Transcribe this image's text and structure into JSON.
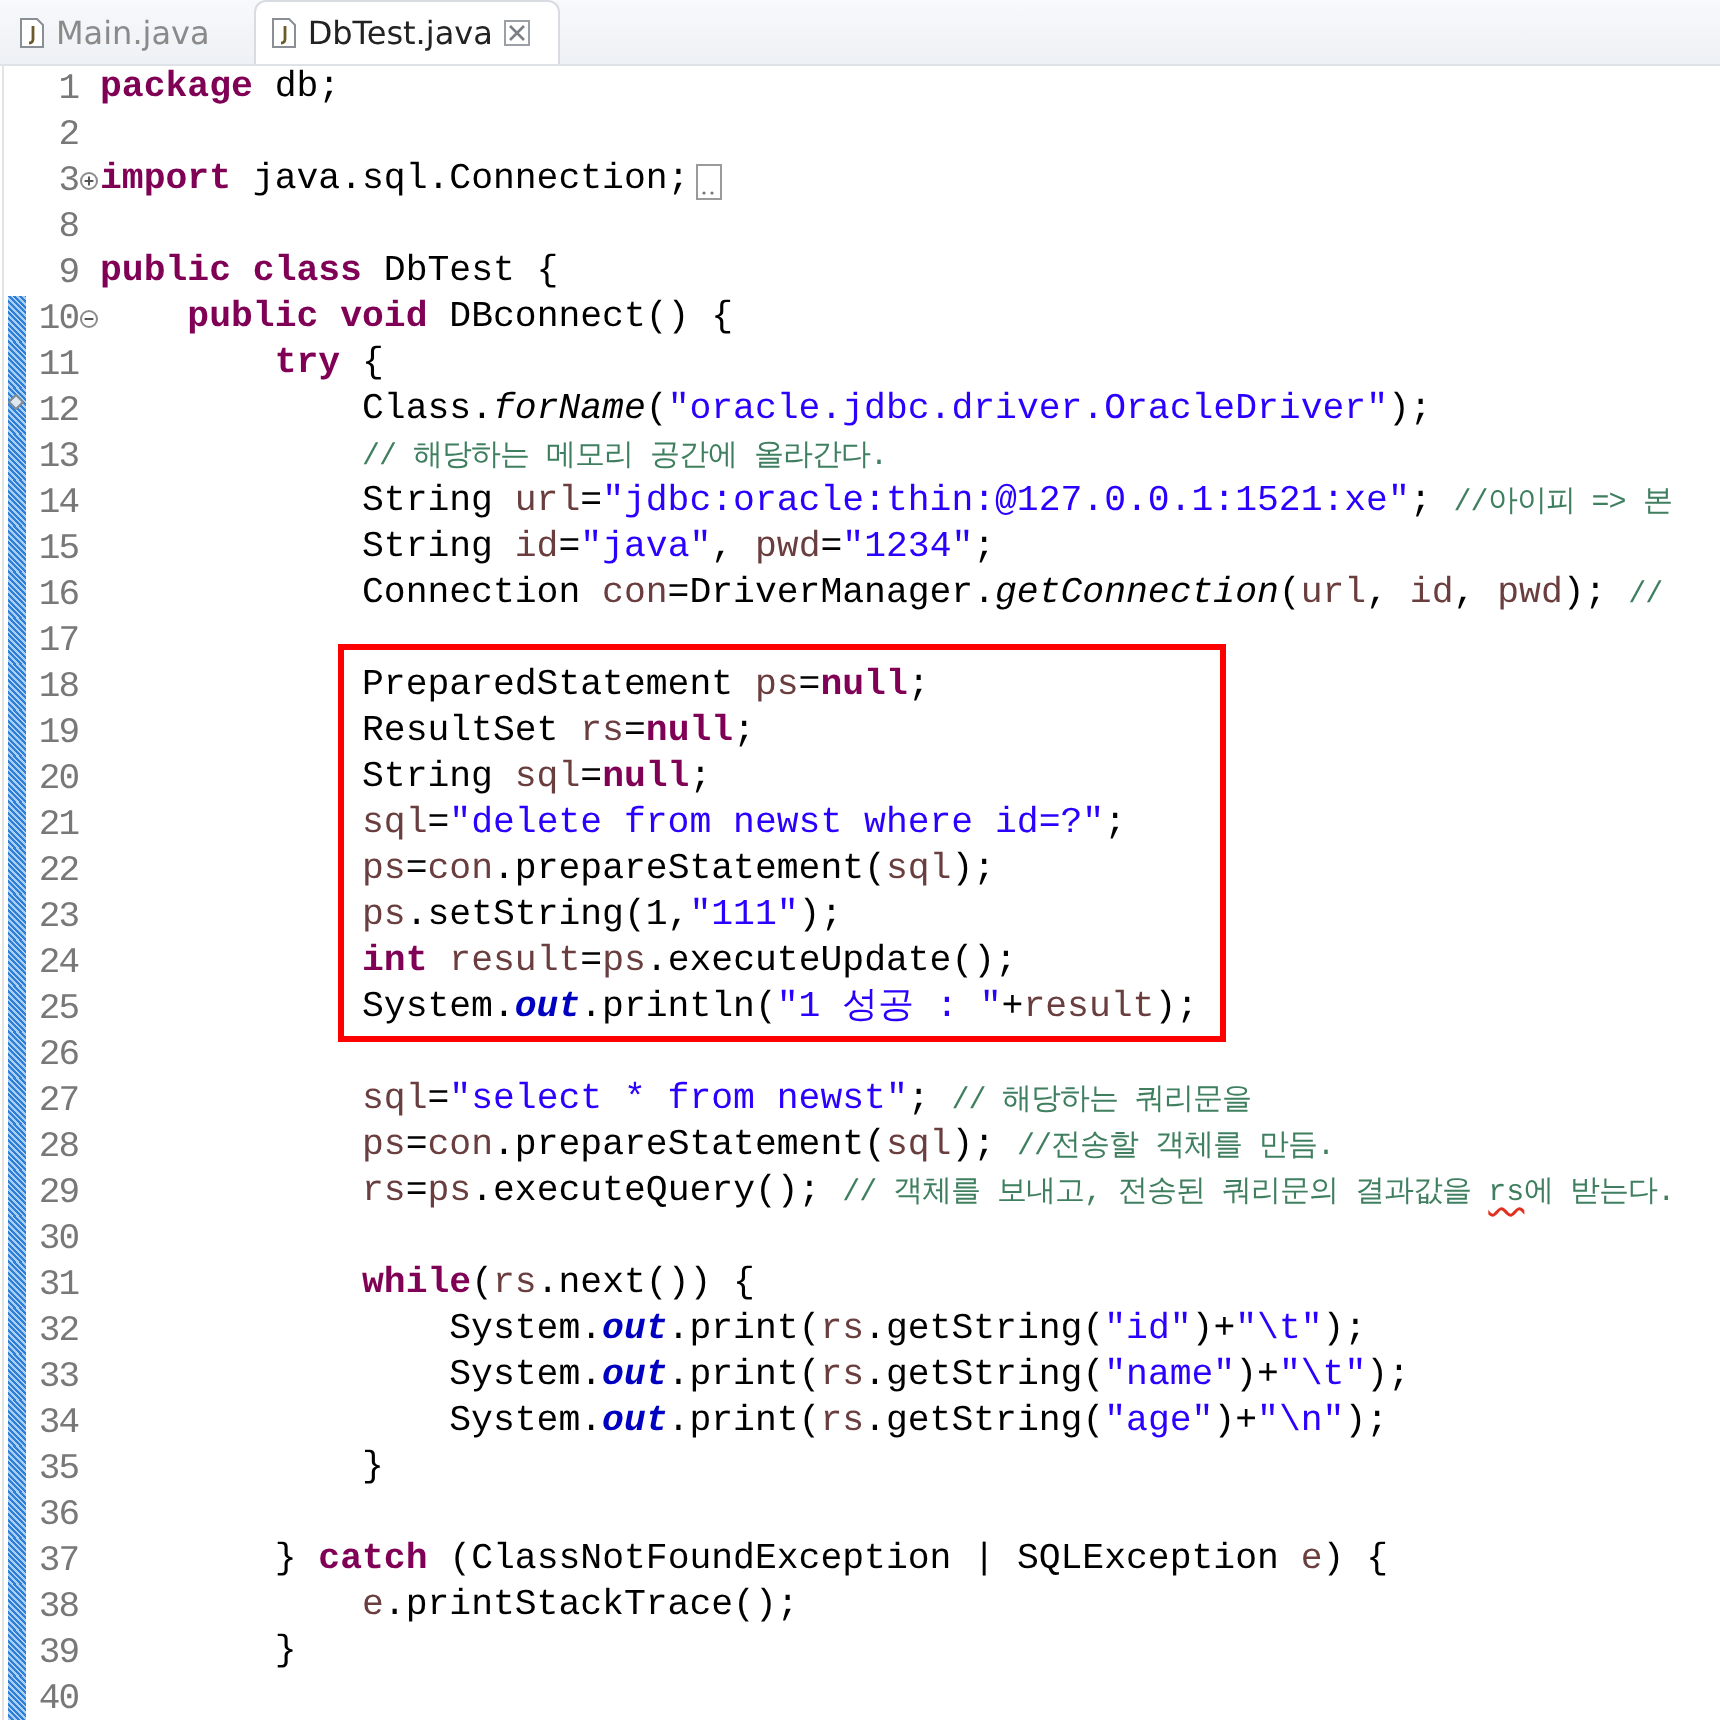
{
  "tabs": [
    {
      "label": "Main.java",
      "selected": false,
      "closable": false
    },
    {
      "label": "DbTest.java",
      "selected": true,
      "closable": true
    }
  ],
  "editor": {
    "lines": [
      {
        "number": "1",
        "changed": false,
        "tokens": [
          {
            "kind": "keyword",
            "text": "package"
          },
          {
            "kind": "plain",
            "text": " db;"
          }
        ]
      },
      {
        "number": "2",
        "changed": false
      },
      {
        "number": "3",
        "changed": false,
        "expanded": false,
        "tokens": [
          {
            "kind": "keyword",
            "text": "import"
          },
          {
            "kind": "plain",
            "text": " java.sql.Connection;"
          }
        ]
      },
      {
        "number": "8",
        "changed": false
      },
      {
        "number": "9",
        "changed": false,
        "tokens": [
          {
            "kind": "keyword",
            "text": "public class"
          },
          {
            "kind": "plain",
            "text": " DbTest {"
          }
        ]
      },
      {
        "number": "10",
        "changed": true,
        "expanded": true,
        "tokens": [
          {
            "kind": "keyword",
            "text": "    public void"
          },
          {
            "kind": "plain",
            "text": " DBconnect() {"
          }
        ]
      },
      {
        "number": "11",
        "changed": true,
        "tokens": [
          {
            "kind": "keyword",
            "text": "        try"
          },
          {
            "kind": "plain",
            "text": " {"
          }
        ]
      },
      {
        "number": "12",
        "changed": true,
        "annotation": true,
        "tokens": [
          {
            "kind": "plain",
            "text": "            Class."
          },
          {
            "kind": "static",
            "text": "forName"
          },
          {
            "kind": "plain",
            "text": "("
          },
          {
            "kind": "string",
            "text": "\"oracle.jdbc.driver.OracleDriver\""
          },
          {
            "kind": "plain",
            "text": ");"
          }
        ]
      },
      {
        "number": "13",
        "changed": true,
        "tokens": [
          {
            "kind": "comment",
            "text": "            // 해당하는 메모리 공간에 올라간다."
          }
        ]
      },
      {
        "number": "14",
        "changed": true,
        "tokens": [
          {
            "kind": "plain",
            "text": "            String "
          },
          {
            "kind": "var",
            "text": "url"
          },
          {
            "kind": "plain",
            "text": "="
          },
          {
            "kind": "string",
            "text": "\"jdbc:oracle:thin:@127.0.0.1:1521:xe\""
          },
          {
            "kind": "plain",
            "text": "; "
          },
          {
            "kind": "comment",
            "text": "//아이피 => 본"
          }
        ]
      },
      {
        "number": "15",
        "changed": true,
        "tokens": [
          {
            "kind": "plain",
            "text": "            String "
          },
          {
            "kind": "var",
            "text": "id"
          },
          {
            "kind": "plain",
            "text": "="
          },
          {
            "kind": "string",
            "text": "\"java\""
          },
          {
            "kind": "plain",
            "text": ", "
          },
          {
            "kind": "var",
            "text": "pwd"
          },
          {
            "kind": "plain",
            "text": "="
          },
          {
            "kind": "string",
            "text": "\"1234\""
          },
          {
            "kind": "plain",
            "text": ";"
          }
        ]
      },
      {
        "number": "16",
        "changed": true,
        "tokens": [
          {
            "kind": "plain",
            "text": "            Connection "
          },
          {
            "kind": "var",
            "text": "con"
          },
          {
            "kind": "plain",
            "text": "=DriverManager."
          },
          {
            "kind": "static",
            "text": "getConnection"
          },
          {
            "kind": "plain",
            "text": "("
          },
          {
            "kind": "var",
            "text": "url"
          },
          {
            "kind": "plain",
            "text": ", "
          },
          {
            "kind": "var",
            "text": "id"
          },
          {
            "kind": "plain",
            "text": ", "
          },
          {
            "kind": "var",
            "text": "pwd"
          },
          {
            "kind": "plain",
            "text": "); "
          },
          {
            "kind": "comment",
            "text": "//"
          }
        ]
      },
      {
        "number": "17",
        "changed": true
      },
      {
        "kind": "highlight",
        "lines": [
          {
            "number": "18",
            "changed": true,
            "tokens": [
              {
                "kind": "plain",
                "text": "            PreparedStatement "
              },
              {
                "kind": "var",
                "text": "ps"
              },
              {
                "kind": "plain",
                "text": "="
              },
              {
                "kind": "keyword",
                "text": "null"
              },
              {
                "kind": "plain",
                "text": ";"
              }
            ]
          },
          {
            "number": "19",
            "changed": true,
            "tokens": [
              {
                "kind": "plain",
                "text": "            ResultSet "
              },
              {
                "kind": "var",
                "text": "rs"
              },
              {
                "kind": "plain",
                "text": "="
              },
              {
                "kind": "keyword",
                "text": "null"
              },
              {
                "kind": "plain",
                "text": ";"
              }
            ]
          },
          {
            "number": "20",
            "changed": true,
            "tokens": [
              {
                "kind": "plain",
                "text": "            String "
              },
              {
                "kind": "var",
                "text": "sql"
              },
              {
                "kind": "plain",
                "text": "="
              },
              {
                "kind": "keyword",
                "text": "null"
              },
              {
                "kind": "plain",
                "text": ";"
              }
            ]
          },
          {
            "number": "21",
            "changed": true,
            "tokens": [
              {
                "kind": "var",
                "text": "            sql"
              },
              {
                "kind": "plain",
                "text": "="
              },
              {
                "kind": "string",
                "text": "\"delete from newst where id=?\""
              },
              {
                "kind": "plain",
                "text": ";"
              }
            ]
          },
          {
            "number": "22",
            "changed": true,
            "tokens": [
              {
                "kind": "var",
                "text": "            ps"
              },
              {
                "kind": "plain",
                "text": "="
              },
              {
                "kind": "var",
                "text": "con"
              },
              {
                "kind": "plain",
                "text": ".prepareStatement("
              },
              {
                "kind": "var",
                "text": "sql"
              },
              {
                "kind": "plain",
                "text": ");"
              }
            ]
          },
          {
            "number": "23",
            "changed": true,
            "tokens": [
              {
                "kind": "var",
                "text": "            ps"
              },
              {
                "kind": "plain",
                "text": ".setString(1,"
              },
              {
                "kind": "string",
                "text": "\"111\""
              },
              {
                "kind": "plain",
                "text": ");"
              }
            ]
          },
          {
            "number": "24",
            "changed": true,
            "tokens": [
              {
                "kind": "keyword",
                "text": "            int"
              },
              {
                "kind": "var",
                "text": " result"
              },
              {
                "kind": "plain",
                "text": "="
              },
              {
                "kind": "var",
                "text": "ps"
              },
              {
                "kind": "plain",
                "text": ".executeUpdate();"
              }
            ]
          },
          {
            "number": "25",
            "changed": true,
            "tokens": [
              {
                "kind": "plain",
                "text": "            System."
              },
              {
                "kind": "field",
                "text": "out"
              },
              {
                "kind": "plain",
                "text": ".println("
              },
              {
                "kind": "string",
                "text": "\"1 성공 : \""
              },
              {
                "kind": "plain",
                "text": "+"
              },
              {
                "kind": "var",
                "text": "result"
              },
              {
                "kind": "plain",
                "text": ");"
              }
            ]
          }
        ]
      },
      {
        "number": "26",
        "changed": true
      },
      {
        "number": "27",
        "changed": true,
        "tokens": [
          {
            "kind": "var",
            "text": "            sql"
          },
          {
            "kind": "plain",
            "text": "="
          },
          {
            "kind": "string",
            "text": "\"select * from newst\""
          },
          {
            "kind": "plain",
            "text": "; "
          },
          {
            "kind": "comment",
            "text": "// 해당하는 쿼리문을"
          }
        ]
      },
      {
        "number": "28",
        "changed": true,
        "tokens": [
          {
            "kind": "var",
            "text": "            ps"
          },
          {
            "kind": "plain",
            "text": "="
          },
          {
            "kind": "var",
            "text": "con"
          },
          {
            "kind": "plain",
            "text": ".prepareStatement("
          },
          {
            "kind": "var",
            "text": "sql"
          },
          {
            "kind": "plain",
            "text": "); "
          },
          {
            "kind": "comment",
            "text": "//전송할 객체를 만듬."
          }
        ]
      },
      {
        "number": "29",
        "changed": true,
        "tokens": [
          {
            "kind": "var",
            "text": "            rs"
          },
          {
            "kind": "plain",
            "text": "="
          },
          {
            "kind": "var",
            "text": "ps"
          },
          {
            "kind": "plain",
            "text": ".executeQuery(); "
          },
          {
            "kind": "comment",
            "text": "// 객체를 보내고, 전송된 쿼리문의 결과값을 "
          },
          {
            "kind": "misspelled",
            "text": "rs"
          },
          {
            "kind": "comment",
            "text": "에 받는다."
          }
        ]
      },
      {
        "number": "30",
        "changed": true
      },
      {
        "number": "31",
        "changed": true,
        "tokens": [
          {
            "kind": "keyword",
            "text": "            while"
          },
          {
            "kind": "plain",
            "text": "("
          },
          {
            "kind": "var",
            "text": "rs"
          },
          {
            "kind": "plain",
            "text": ".next()) {"
          }
        ]
      },
      {
        "number": "32",
        "changed": true,
        "tokens": [
          {
            "kind": "plain",
            "text": "                System."
          },
          {
            "kind": "field",
            "text": "out"
          },
          {
            "kind": "plain",
            "text": ".print("
          },
          {
            "kind": "var",
            "text": "rs"
          },
          {
            "kind": "plain",
            "text": ".getString("
          },
          {
            "kind": "string",
            "text": "\"id\""
          },
          {
            "kind": "plain",
            "text": ")+"
          },
          {
            "kind": "string",
            "text": "\"\\t\""
          },
          {
            "kind": "plain",
            "text": ");"
          }
        ]
      },
      {
        "number": "33",
        "changed": true,
        "tokens": [
          {
            "kind": "plain",
            "text": "                System."
          },
          {
            "kind": "field",
            "text": "out"
          },
          {
            "kind": "plain",
            "text": ".print("
          },
          {
            "kind": "var",
            "text": "rs"
          },
          {
            "kind": "plain",
            "text": ".getString("
          },
          {
            "kind": "string",
            "text": "\"name\""
          },
          {
            "kind": "plain",
            "text": ")+"
          },
          {
            "kind": "string",
            "text": "\"\\t\""
          },
          {
            "kind": "plain",
            "text": ");"
          }
        ]
      },
      {
        "number": "34",
        "changed": true,
        "tokens": [
          {
            "kind": "plain",
            "text": "                System."
          },
          {
            "kind": "field",
            "text": "out"
          },
          {
            "kind": "plain",
            "text": ".print("
          },
          {
            "kind": "var",
            "text": "rs"
          },
          {
            "kind": "plain",
            "text": ".getString("
          },
          {
            "kind": "string",
            "text": "\"age\""
          },
          {
            "kind": "plain",
            "text": ")+"
          },
          {
            "kind": "string",
            "text": "\"\\n\""
          },
          {
            "kind": "plain",
            "text": ");"
          }
        ]
      },
      {
        "number": "35",
        "changed": true,
        "tokens": [
          {
            "kind": "plain",
            "text": "            }"
          }
        ]
      },
      {
        "number": "36",
        "changed": true
      },
      {
        "number": "37",
        "changed": true,
        "tokens": [
          {
            "kind": "plain",
            "text": "        } "
          },
          {
            "kind": "keyword",
            "text": "catch"
          },
          {
            "kind": "plain",
            "text": " (ClassNotFoundException | SQLException "
          },
          {
            "kind": "var",
            "text": "e"
          },
          {
            "kind": "plain",
            "text": ") {"
          }
        ]
      },
      {
        "number": "38",
        "changed": true,
        "tokens": [
          {
            "kind": "var",
            "text": "            e"
          },
          {
            "kind": "plain",
            "text": ".printStackTrace();"
          }
        ]
      },
      {
        "number": "39",
        "changed": true,
        "tokens": [
          {
            "kind": "plain",
            "text": "        }"
          }
        ]
      },
      {
        "number": "40",
        "changed": true
      }
    ]
  }
}
